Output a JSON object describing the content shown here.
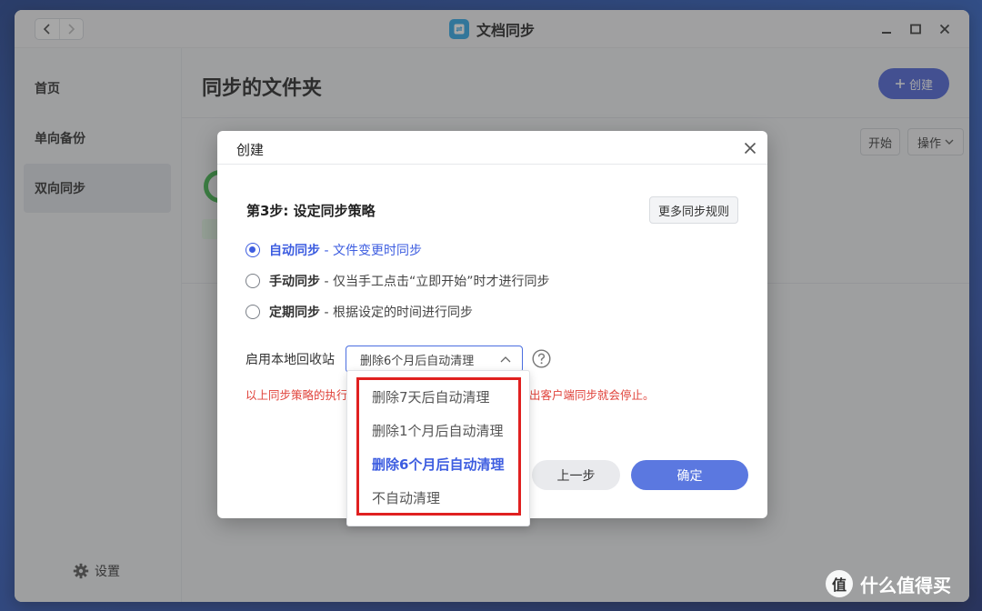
{
  "app": {
    "title": "文档同步"
  },
  "sidebar": {
    "items": [
      {
        "label": "首页"
      },
      {
        "label": "单向备份"
      },
      {
        "label": "双向同步"
      }
    ],
    "settings_label": "设置"
  },
  "main": {
    "title": "同步的文件夹",
    "create_label": "创建",
    "start_label": "开始",
    "action_label": "操作"
  },
  "modal": {
    "title": "创建",
    "step_title": "第3步: 设定同步策略",
    "more_rules_label": "更多同步规则",
    "options": [
      {
        "name": "自动同步",
        "desc": "- 文件变更时同步",
        "checked": true
      },
      {
        "name": "手动同步",
        "desc": "- 仅当手工点击“立即开始”时才进行同步",
        "checked": false
      },
      {
        "name": "定期同步",
        "desc": "- 根据设定的时间进行同步",
        "checked": false
      }
    ],
    "recycle_label": "启用本地回收站",
    "recycle_value": "删除6个月后自动清理",
    "warning_left": "以上同步策略的执行",
    "warning_right": "出客户端同步就会停止。",
    "prev_label": "上一步",
    "ok_label": "确定"
  },
  "dropdown": {
    "options": [
      {
        "label": "删除7天后自动清理",
        "selected": false
      },
      {
        "label": "删除1个月后自动清理",
        "selected": false
      },
      {
        "label": "删除6个月后自动清理",
        "selected": true
      },
      {
        "label": "不自动清理",
        "selected": false
      }
    ]
  },
  "watermark": {
    "text": "什么值得买",
    "glyph": "值"
  },
  "colors": {
    "accent": "#3d5de0",
    "primary_button": "#5b78e0",
    "warning": "#e0433b",
    "highlight": "#e02020",
    "success": "#3db449"
  }
}
